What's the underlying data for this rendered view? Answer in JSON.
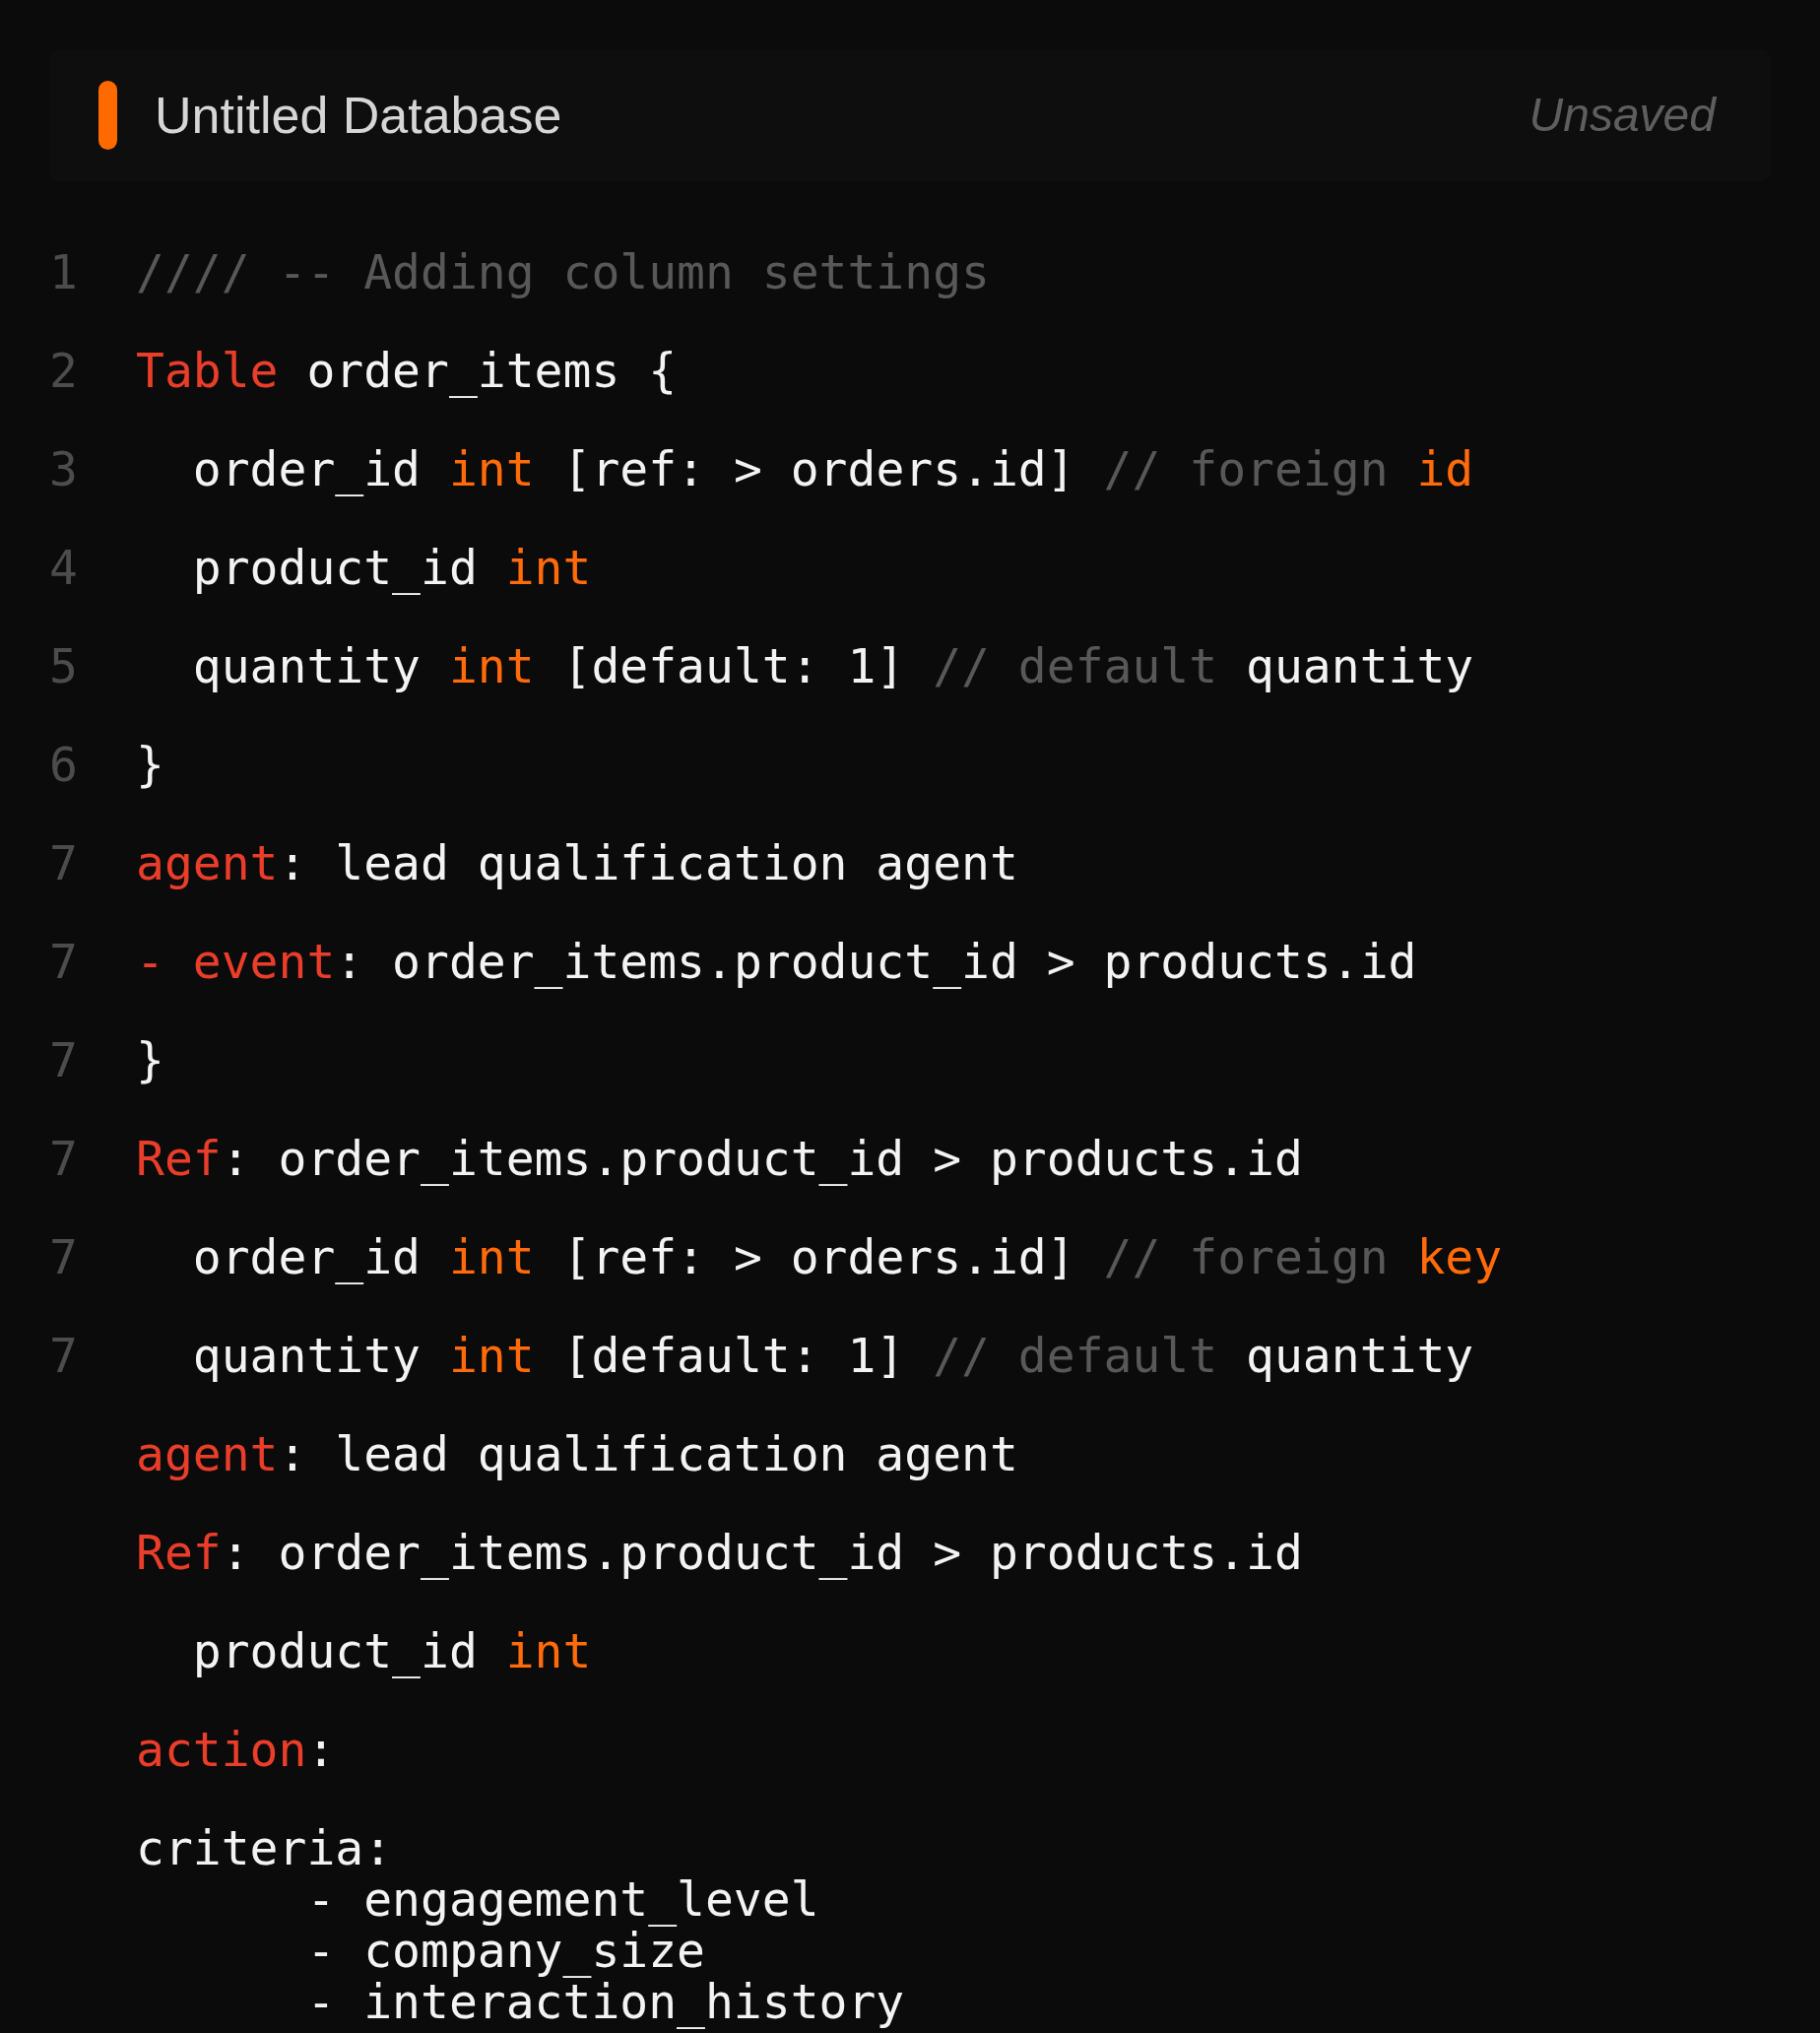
{
  "header": {
    "title": "Untitled Database",
    "status": "Unsaved"
  },
  "editor": {
    "lines": [
      {
        "number": "1",
        "tokens": [
          {
            "text": "//// -- Adding column settings",
            "kind": "comment"
          }
        ]
      },
      {
        "number": "2",
        "tokens": [
          {
            "text": "Table",
            "kind": "keyword"
          },
          {
            "text": " order_items {",
            "kind": "plain"
          }
        ]
      },
      {
        "number": "3",
        "tokens": [
          {
            "text": "  order_id ",
            "kind": "plain"
          },
          {
            "text": "int",
            "kind": "type"
          },
          {
            "text": " [ref: > orders.id] ",
            "kind": "plain"
          },
          {
            "text": "// foreign ",
            "kind": "comment"
          },
          {
            "text": "id",
            "kind": "type"
          }
        ]
      },
      {
        "number": "4",
        "tokens": [
          {
            "text": "  product_id ",
            "kind": "plain"
          },
          {
            "text": "int",
            "kind": "type"
          }
        ]
      },
      {
        "number": "5",
        "tokens": [
          {
            "text": "  quantity ",
            "kind": "plain"
          },
          {
            "text": "int",
            "kind": "type"
          },
          {
            "text": " [default: 1] ",
            "kind": "plain"
          },
          {
            "text": "// default ",
            "kind": "comment"
          },
          {
            "text": "quantity",
            "kind": "plain"
          }
        ]
      },
      {
        "number": "6",
        "tokens": [
          {
            "text": "}",
            "kind": "plain"
          }
        ]
      },
      {
        "number": "7",
        "tokens": [
          {
            "text": "agent",
            "kind": "keyword"
          },
          {
            "text": ": lead qualification agent",
            "kind": "plain"
          }
        ]
      },
      {
        "number": "7",
        "tokens": [
          {
            "text": "- event",
            "kind": "keyword"
          },
          {
            "text": ": order_items.product_id > products.id",
            "kind": "plain"
          }
        ]
      },
      {
        "number": "7",
        "tokens": [
          {
            "text": "}",
            "kind": "plain"
          }
        ]
      },
      {
        "number": "7",
        "tokens": [
          {
            "text": "Ref",
            "kind": "keyword"
          },
          {
            "text": ": order_items.product_id > products.id",
            "kind": "plain"
          }
        ]
      },
      {
        "number": "7",
        "tokens": [
          {
            "text": "  order_id ",
            "kind": "plain"
          },
          {
            "text": "int",
            "kind": "type"
          },
          {
            "text": " [ref: > orders.id] ",
            "kind": "plain"
          },
          {
            "text": "// foreign ",
            "kind": "comment"
          },
          {
            "text": "key",
            "kind": "type"
          }
        ]
      },
      {
        "number": "7",
        "tokens": [
          {
            "text": "  quantity ",
            "kind": "plain"
          },
          {
            "text": "int",
            "kind": "type"
          },
          {
            "text": " [default: 1] ",
            "kind": "plain"
          },
          {
            "text": "// default ",
            "kind": "comment"
          },
          {
            "text": "quantity",
            "kind": "plain"
          }
        ]
      },
      {
        "tokens": [
          {
            "text": "agent",
            "kind": "keyword"
          },
          {
            "text": ": lead qualification agent",
            "kind": "plain"
          }
        ]
      },
      {
        "tokens": [
          {
            "text": "Ref",
            "kind": "keyword"
          },
          {
            "text": ": order_items.product_id > products.id",
            "kind": "plain"
          }
        ]
      },
      {
        "tokens": [
          {
            "text": "  product_id ",
            "kind": "plain"
          },
          {
            "text": "int",
            "kind": "type"
          }
        ]
      },
      {
        "tokens": [
          {
            "text": "action",
            "kind": "keyword"
          },
          {
            "text": ":",
            "kind": "plain"
          }
        ]
      },
      {
        "tokens": [
          {
            "text": "criteria:",
            "kind": "plain"
          }
        ],
        "sublines": [
          "      - engagement_level",
          "      - company_size",
          "      - interaction_history"
        ]
      }
    ]
  }
}
